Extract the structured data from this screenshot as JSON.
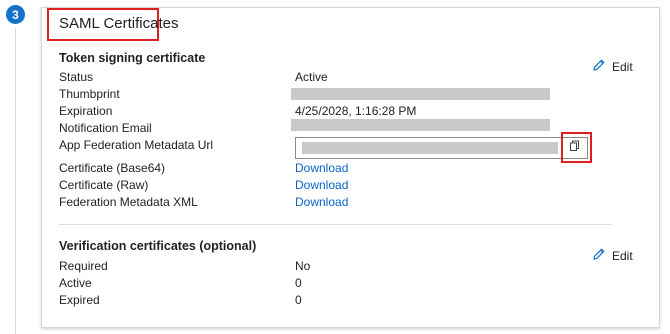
{
  "step": {
    "number": "3"
  },
  "card": {
    "title": "SAML Certificates"
  },
  "token_signing": {
    "title": "Token signing certificate",
    "edit_label": "Edit",
    "rows": {
      "status": {
        "label": "Status",
        "value": "Active"
      },
      "thumbprint": {
        "label": "Thumbprint"
      },
      "expiration": {
        "label": "Expiration",
        "value": "4/25/2028, 1:16:28 PM"
      },
      "notification_email": {
        "label": "Notification Email"
      },
      "metadata_url": {
        "label": "App Federation Metadata Url"
      },
      "cert_base64": {
        "label": "Certificate (Base64)",
        "value": "Download"
      },
      "cert_raw": {
        "label": "Certificate (Raw)",
        "value": "Download"
      },
      "federation_xml": {
        "label": "Federation Metadata XML",
        "value": "Download"
      }
    }
  },
  "verification": {
    "title": "Verification certificates (optional)",
    "edit_label": "Edit",
    "rows": {
      "required": {
        "label": "Required",
        "value": "No"
      },
      "active": {
        "label": "Active",
        "value": "0"
      },
      "expired": {
        "label": "Expired",
        "value": "0"
      }
    }
  },
  "colors": {
    "accent": "#1473c8",
    "link": "#0b63c7",
    "highlight": "#e02020",
    "redaction": "#c9c9c9"
  },
  "icons": {
    "edit": "pencil-icon",
    "copy": "copy-icon"
  }
}
